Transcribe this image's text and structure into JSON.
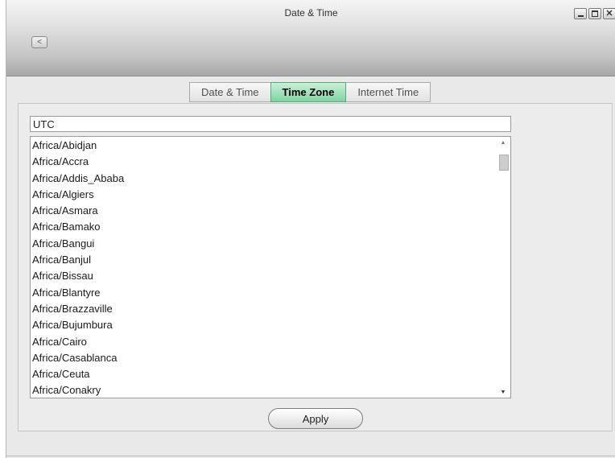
{
  "window": {
    "title": "Date & Time",
    "back_label": "<"
  },
  "tabs": [
    {
      "label": "Date & Time",
      "active": false
    },
    {
      "label": "Time Zone",
      "active": true
    },
    {
      "label": "Internet Time",
      "active": false
    }
  ],
  "timezone": {
    "input_value": "UTC",
    "list": [
      "Africa/Abidjan",
      "Africa/Accra",
      "Africa/Addis_Ababa",
      "Africa/Algiers",
      "Africa/Asmara",
      "Africa/Bamako",
      "Africa/Bangui",
      "Africa/Banjul",
      "Africa/Bissau",
      "Africa/Blantyre",
      "Africa/Brazzaville",
      "Africa/Bujumbura",
      "Africa/Cairo",
      "Africa/Casablanca",
      "Africa/Ceuta",
      "Africa/Conakry"
    ]
  },
  "apply_label": "Apply",
  "colors": {
    "active_tab": "#7fd3a2",
    "active_tab_border": "#5aa87a"
  },
  "icons": {
    "back": "chevron-left-icon",
    "minimize": "minimize-icon",
    "maximize": "maximize-icon",
    "close": "close-icon",
    "scroll_up": "arrow-up-icon",
    "scroll_down": "arrow-down-icon"
  }
}
